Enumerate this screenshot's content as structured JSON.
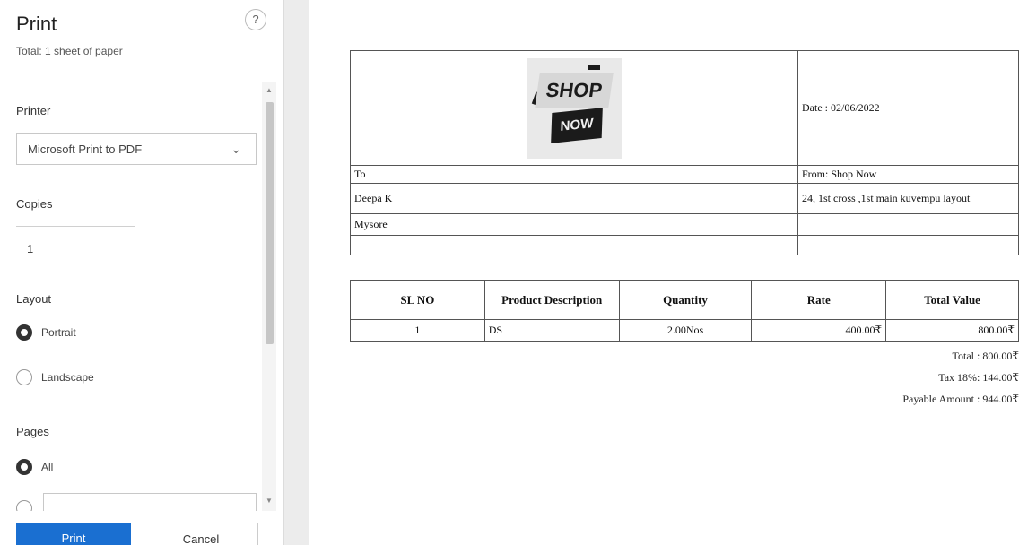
{
  "panel": {
    "title": "Print",
    "subtitle": "Total: 1 sheet of paper",
    "help": "?",
    "printer_label": "Printer",
    "printer_value": "Microsoft Print to PDF",
    "copies_label": "Copies",
    "copies_value": "1",
    "layout_label": "Layout",
    "layout_options": [
      "Portrait",
      "Landscape"
    ],
    "layout_selected": "Portrait",
    "pages_label": "Pages",
    "pages_options": [
      "All"
    ],
    "pages_selected": "All",
    "print_button": "Print",
    "cancel_button": "Cancel"
  },
  "invoice": {
    "logo_text_top": "SHOP",
    "logo_text_bottom": "NOW",
    "date": "Date : 02/06/2022",
    "to_label": "To",
    "to_name": "Deepa K",
    "to_city": "Mysore",
    "from_label": "From: Shop Now",
    "from_address": "24, 1st cross ,1st main kuvempu layout",
    "columns": [
      "SL NO",
      "Product Description",
      "Quantity",
      "Rate",
      "Total Value"
    ],
    "rows": [
      [
        "1",
        "DS",
        "2.00Nos",
        "400.00₹",
        "800.00₹"
      ]
    ],
    "total": "Total : 800.00₹",
    "tax": "Tax 18%: 144.00₹",
    "payable": "Payable Amount : 944.00₹"
  },
  "colors": {
    "accent": "#1a6fd1",
    "divider": "#ececec"
  }
}
